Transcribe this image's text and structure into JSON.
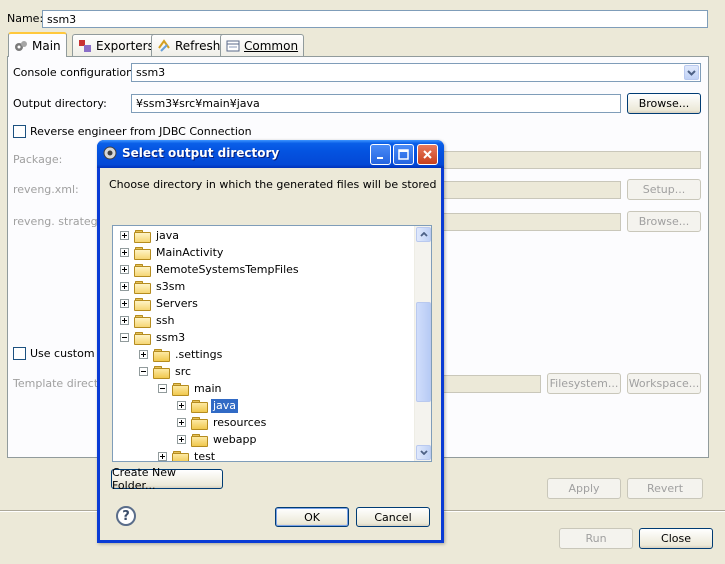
{
  "main": {
    "name_label": "Name:",
    "name_value": "ssm3",
    "tabs": [
      {
        "label": "Main",
        "icon": "main-tab-icon"
      },
      {
        "label": "Exporters",
        "icon": "exporters-icon"
      },
      {
        "label": "Refresh",
        "icon": "refresh-icon"
      },
      {
        "label": "Common",
        "icon": "common-icon"
      }
    ],
    "console_config_label": "Console configuration:",
    "console_config_value": "ssm3",
    "output_dir_label": "Output directory:",
    "output_dir_value": "¥ssm3¥src¥main¥java",
    "browse_label": "Browse...",
    "reverse_engineer_label": "Reverse engineer from JDBC Connection",
    "package_label": "Package:",
    "reveng_xml_label": "reveng.xml:",
    "setup_label": "Setup...",
    "reveng_strategy_label": "reveng. strategy:",
    "browse2_label": "Browse...",
    "use_custom_label": "Use custom t",
    "template_dir_label": "Template directo",
    "filesystem_label": "Filesystem...",
    "workspace_label": "Workspace...",
    "apply_label": "Apply",
    "revert_label": "Revert",
    "run_label": "Run",
    "close_label": "Close"
  },
  "dialog": {
    "title": "Select output directory",
    "instruction": "Choose directory in which the generated files will be stored",
    "tree": [
      {
        "label": "java",
        "depth": 0,
        "expander": "plus",
        "project": true
      },
      {
        "label": "MainActivity",
        "depth": 0,
        "expander": "plus",
        "project": true
      },
      {
        "label": "RemoteSystemsTempFiles",
        "depth": 0,
        "expander": "plus",
        "project": true
      },
      {
        "label": "s3sm",
        "depth": 0,
        "expander": "plus",
        "project": true
      },
      {
        "label": "Servers",
        "depth": 0,
        "expander": "plus",
        "project": true
      },
      {
        "label": "ssh",
        "depth": 0,
        "expander": "plus",
        "project": true
      },
      {
        "label": "ssm3",
        "depth": 0,
        "expander": "minus",
        "project": true
      },
      {
        "label": ".settings",
        "depth": 1,
        "expander": "plus",
        "project": false
      },
      {
        "label": "src",
        "depth": 1,
        "expander": "minus",
        "project": false
      },
      {
        "label": "main",
        "depth": 2,
        "expander": "minus",
        "project": false
      },
      {
        "label": "java",
        "depth": 3,
        "expander": "plus",
        "project": false,
        "selected": true
      },
      {
        "label": "resources",
        "depth": 3,
        "expander": "plus",
        "project": false
      },
      {
        "label": "webapp",
        "depth": 3,
        "expander": "plus",
        "project": false
      },
      {
        "label": "test",
        "depth": 2,
        "expander": "plus",
        "project": false
      }
    ],
    "create_folder_label": "Create New Folder...",
    "help_icon_text": "?",
    "ok_label": "OK",
    "cancel_label": "Cancel"
  },
  "colors": {
    "title_bar": "#0453e0",
    "selection": "#316ac5",
    "window_bg": "#ece9d8"
  }
}
